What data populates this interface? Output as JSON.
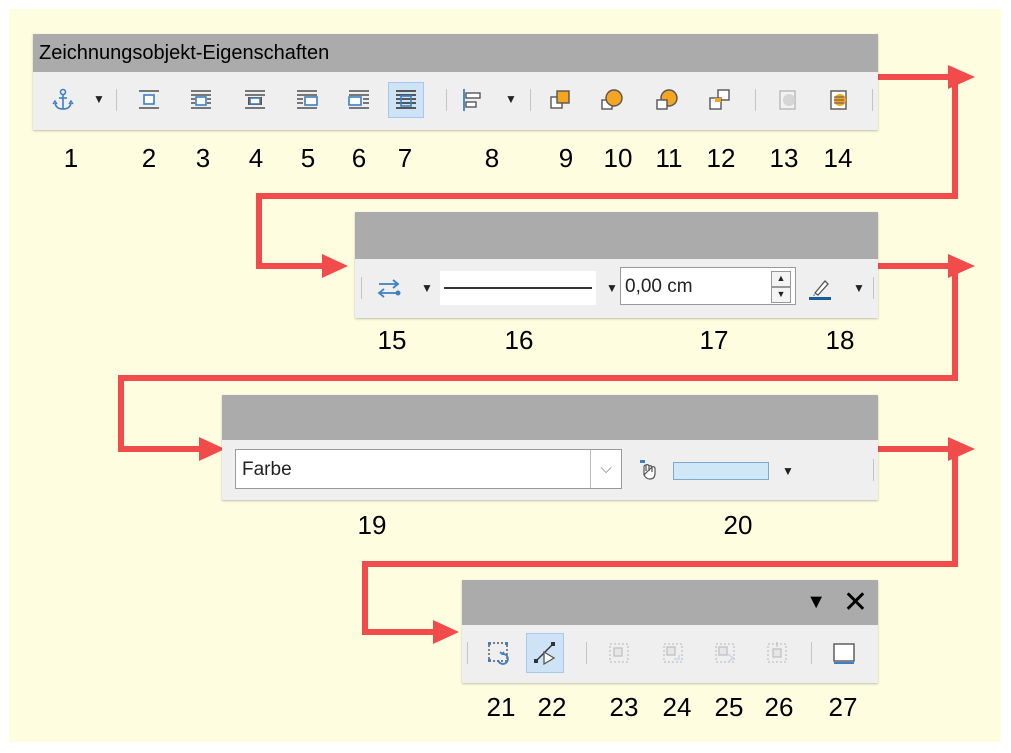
{
  "toolbar1": {
    "title": "Zeichnungsobjekt-Eigenschaften",
    "buttons": [
      {
        "icon": "anchor-icon",
        "label": "1"
      },
      {
        "icon": "wrap-off-icon",
        "label": "2"
      },
      {
        "icon": "wrap-page-icon",
        "label": "3"
      },
      {
        "icon": "wrap-optimal-icon",
        "label": "4"
      },
      {
        "icon": "wrap-left-icon",
        "label": "5"
      },
      {
        "icon": "wrap-right-icon",
        "label": "6"
      },
      {
        "icon": "wrap-through-icon",
        "label": "7"
      },
      {
        "icon": "align-objects-icon",
        "label": "8"
      },
      {
        "icon": "bring-to-front-icon",
        "label": "9"
      },
      {
        "icon": "bring-forward-icon",
        "label": "10"
      },
      {
        "icon": "send-backward-icon",
        "label": "11"
      },
      {
        "icon": "send-to-back-icon",
        "label": "12"
      },
      {
        "icon": "to-foreground-icon",
        "label": "13"
      },
      {
        "icon": "to-background-icon",
        "label": "14"
      }
    ]
  },
  "toolbar2": {
    "title": "",
    "arrow_style_icon": "line-arrow-style-icon",
    "line_width_value": "0,00 cm",
    "line_color_icon": "line-color-icon",
    "labels": [
      "15",
      "16",
      "17",
      "18"
    ]
  },
  "toolbar3": {
    "title": "",
    "area_style_value": "Farbe",
    "fill_color_icon": "fill-color-icon",
    "fill_color": "#cfe7f7",
    "labels": [
      "19",
      "20"
    ]
  },
  "toolbar4": {
    "title": "",
    "menu_glyph": "▼",
    "close_glyph": "✕",
    "buttons": [
      {
        "icon": "rotate-icon",
        "label": "21"
      },
      {
        "icon": "points-edit-icon",
        "label": "22"
      },
      {
        "icon": "group-icon",
        "label": "23"
      },
      {
        "icon": "enter-group-icon",
        "label": "24"
      },
      {
        "icon": "exit-group-icon",
        "label": "25"
      },
      {
        "icon": "ungroup-icon",
        "label": "26"
      },
      {
        "icon": "sidebar-icon",
        "label": "27"
      }
    ]
  },
  "colors": {
    "background": "#fffde0",
    "title_bar": "#ababab",
    "arrow": "#f24b4b",
    "icon_blue": "#3b7fc4",
    "icon_orange": "#f4a623"
  }
}
